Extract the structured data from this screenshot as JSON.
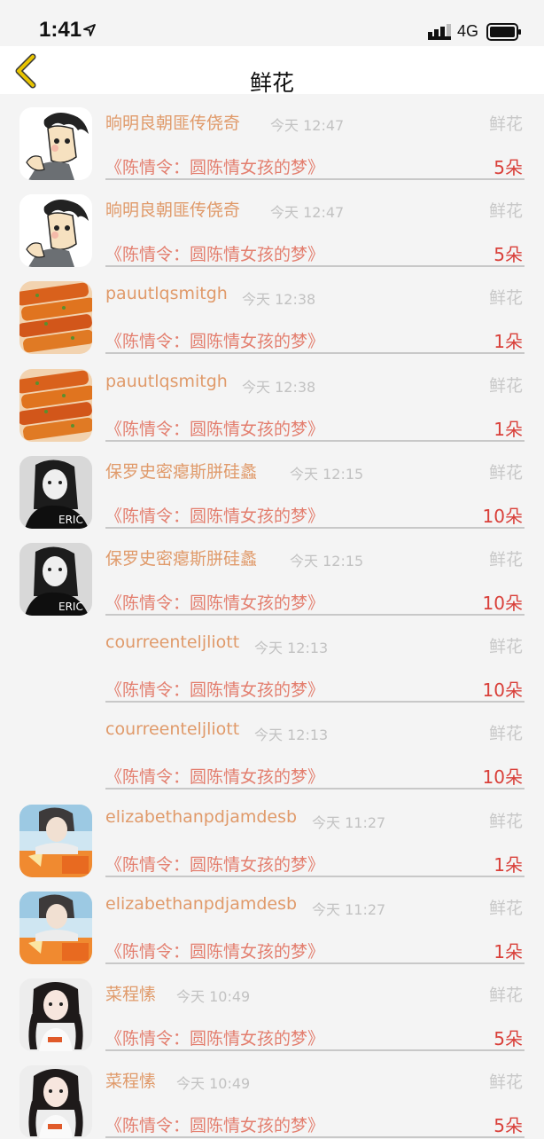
{
  "status": {
    "time": "1:41",
    "network": "4G"
  },
  "nav": {
    "title": "鲜花"
  },
  "rows": [
    {
      "name": "晌明良朝匪传侥奇",
      "time": "今天 12:47",
      "type": "鲜花",
      "work": "《陈情令：圆陈情女孩的梦》",
      "count": "5朵",
      "avatar": "cartoon-avatar"
    },
    {
      "name": "晌明良朝匪传侥奇",
      "time": "今天 12:47",
      "type": "鲜花",
      "work": "《陈情令：圆陈情女孩的梦》",
      "count": "5朵",
      "avatar": "cartoon-avatar"
    },
    {
      "name": "pauutlqsmitgh",
      "time": "今天 12:38",
      "type": "鲜花",
      "work": "《陈情令：圆陈情女孩的梦》",
      "count": "1朵",
      "avatar": "food-avatar"
    },
    {
      "name": "pauutlqsmitgh",
      "time": "今天 12:38",
      "type": "鲜花",
      "work": "《陈情令：圆陈情女孩的梦》",
      "count": "1朵",
      "avatar": "food-avatar"
    },
    {
      "name": "保罗史密瘪斯胼硅蠡",
      "time": "今天 12:15",
      "type": "鲜花",
      "work": "《陈情令：圆陈情女孩的梦》",
      "count": "10朵",
      "avatar": "girl-bw-avatar"
    },
    {
      "name": "保罗史密瘪斯胼硅蠡",
      "time": "今天 12:15",
      "type": "鲜花",
      "work": "《陈情令：圆陈情女孩的梦》",
      "count": "10朵",
      "avatar": "girl-bw-avatar"
    },
    {
      "name": "courreenteljliott",
      "time": "今天 12:13",
      "type": "鲜花",
      "work": "《陈情令：圆陈情女孩的梦》",
      "count": "10朵",
      "avatar": ""
    },
    {
      "name": "courreenteljliott",
      "time": "今天 12:13",
      "type": "鲜花",
      "work": "《陈情令：圆陈情女孩的梦》",
      "count": "10朵",
      "avatar": ""
    },
    {
      "name": "elizabethanpdjamdesb",
      "time": "今天 11:27",
      "type": "鲜花",
      "work": "《陈情令：圆陈情女孩的梦》",
      "count": "1朵",
      "avatar": "boy-photo-avatar"
    },
    {
      "name": "elizabethanpdjamdesb",
      "time": "今天 11:27",
      "type": "鲜花",
      "work": "《陈情令：圆陈情女孩的梦》",
      "count": "1朵",
      "avatar": "boy-photo-avatar"
    },
    {
      "name": "菜程愫",
      "time": "今天 10:49",
      "type": "鲜花",
      "work": "《陈情令：圆陈情女孩的梦》",
      "count": "5朵",
      "avatar": "girl-braids-avatar"
    },
    {
      "name": "菜程愫",
      "time": "今天 10:49",
      "type": "鲜花",
      "work": "《陈情令：圆陈情女孩的梦》",
      "count": "5朵",
      "avatar": "girl-braids-avatar"
    }
  ],
  "colors": {
    "name": "#e09a6a",
    "work": "#e37e6e",
    "count": "#d9403a",
    "back_arrow": "#e8c400"
  }
}
